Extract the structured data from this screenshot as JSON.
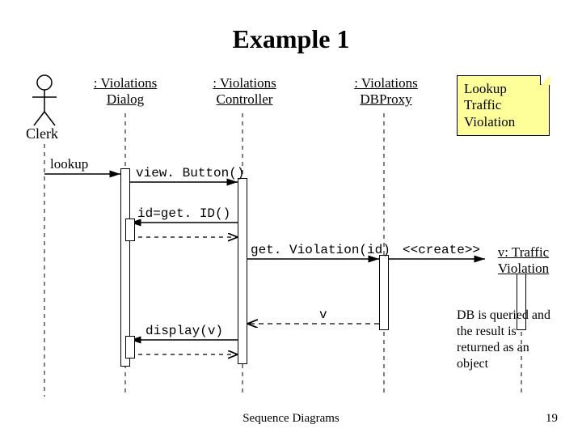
{
  "title": "Example 1",
  "actor": {
    "name": "Clerk"
  },
  "participants": {
    "dialog": ": Violations Dialog",
    "controller": ": Violations Controller",
    "dbproxy": ": Violations DBProxy",
    "violation": "v: Traffic Violation"
  },
  "messages": {
    "lookup": "lookup",
    "viewButton": "view. Button()",
    "getId": "id=get. ID()",
    "getViolation": "get. Violation(id)",
    "create": "<<create>>",
    "returnV": "v",
    "display": "display(v)"
  },
  "notes": {
    "lookup_note": "Lookup Traffic Violation",
    "db_note": "DB is queried and the result is returned as an object"
  },
  "footer": {
    "caption": "Sequence Diagrams",
    "page": "19"
  },
  "chart_data": {
    "type": "sequence-diagram",
    "actor": "Clerk",
    "participants": [
      ":Violations Dialog",
      ":Violations Controller",
      ":Violations DBProxy",
      "v:Traffic Violation"
    ],
    "messages": [
      {
        "from": "Clerk",
        "to": ":Violations Dialog",
        "label": "lookup",
        "kind": "async"
      },
      {
        "from": ":Violations Dialog",
        "to": ":Violations Controller",
        "label": "view.Button()",
        "kind": "sync"
      },
      {
        "from": ":Violations Controller",
        "to": ":Violations Dialog",
        "label": "id=get.ID()",
        "kind": "sync-self-return"
      },
      {
        "from": ":Violations Controller",
        "to": ":Violations DBProxy",
        "label": "get.Violation(id)",
        "kind": "sync"
      },
      {
        "from": ":Violations DBProxy",
        "to": "v:Traffic Violation",
        "label": "<<create>>",
        "kind": "create"
      },
      {
        "from": ":Violations DBProxy",
        "to": ":Violations Controller",
        "label": "v",
        "kind": "return"
      },
      {
        "from": ":Violations Controller",
        "to": ":Violations Dialog",
        "label": "display(v)",
        "kind": "sync"
      }
    ],
    "notes": [
      {
        "text": "Lookup Traffic Violation",
        "attached_to": "top-right"
      },
      {
        "text": "DB is queried and the result is returned as an object",
        "attached_to": "return v"
      }
    ]
  }
}
